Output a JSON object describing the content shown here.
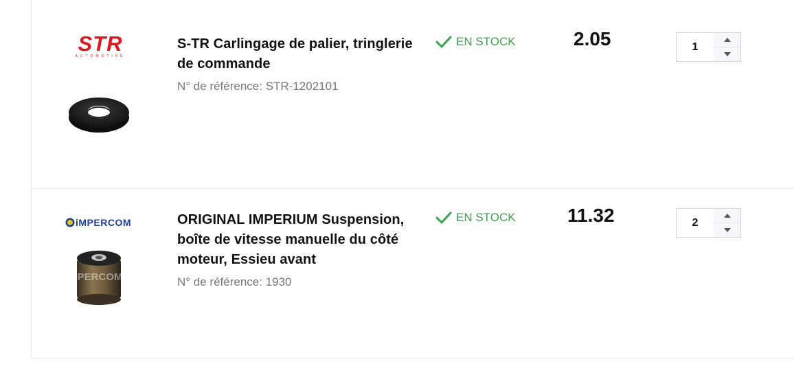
{
  "items": [
    {
      "brand": {
        "name": "STR",
        "tagline": "AUTOMOTIVE",
        "color": "#e0161f"
      },
      "title": "S-TR Carlingage de palier, tringlerie de commande",
      "reference": "N° de référence: STR-1202101",
      "stock": "EN STOCK",
      "price": "2.05",
      "quantity": "1",
      "image": "rubber-bearing-ring"
    },
    {
      "brand": {
        "name": "iMPERCOM",
        "color": "#1c3f8f"
      },
      "title": "ORIGINAL IMPERIUM Suspension, boîte de vitesse manuelle du côté moteur, Essieu avant",
      "reference": "N° de référence: 1930",
      "stock": "EN STOCK",
      "price": "11.32",
      "quantity": "2",
      "image": "rubber-metal-bushing",
      "watermark": "iMPERCOM."
    }
  ],
  "colors": {
    "stock_green": "#3aa24b",
    "border": "#e3e3e3",
    "ref_gray": "#777777"
  },
  "icons": {
    "stock": "check-icon",
    "increment": "caret-up-icon",
    "decrement": "caret-down-icon"
  }
}
